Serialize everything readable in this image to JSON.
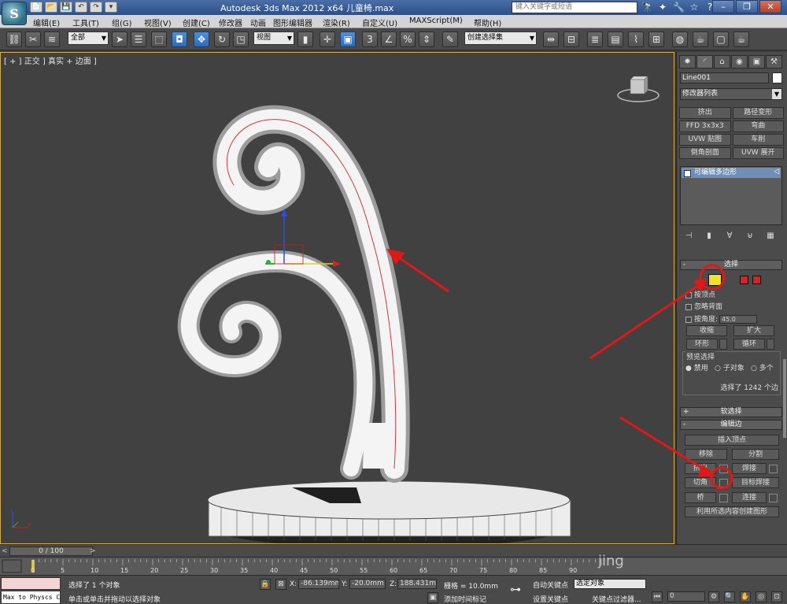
{
  "titlebar": {
    "title": "Autodesk 3ds Max  2012 x64      儿童椅.max",
    "help_search_placeholder": "键入关键字或短语",
    "quick_access": [
      "📄",
      "📂",
      "💾",
      "↶",
      "↷",
      "▾"
    ],
    "icons": [
      "🔭",
      "✦",
      "🔧",
      "☆",
      "?"
    ],
    "window_controls": [
      "–",
      "❐",
      "✕"
    ]
  },
  "menu": {
    "items": [
      "编辑(E)",
      "工具(T)",
      "组(G)",
      "视图(V)",
      "创建(C)",
      "修改器",
      "动画",
      "图形编辑器",
      "渲染(R)",
      "自定义(U)",
      "MAXScript(M)",
      "帮助(H)"
    ]
  },
  "toolbar": {
    "selection_filter": "全部",
    "reference_coord": "视图",
    "named_selection": "创建选择集",
    "snap_label": "3",
    "percent_snap": "%"
  },
  "viewport": {
    "label": "[ + ] 正交 ] 真实 + 边面 ]",
    "active_border": "#d7b04a",
    "background": "#414141"
  },
  "command_panel": {
    "object_name": "Line001",
    "object_color": "#ffffff",
    "modifier_list": "修改器列表",
    "modifier_buttons": [
      "挤出",
      "路径变形",
      "FFD 3x3x3",
      "弯曲",
      "UVW 贴图",
      "车削",
      "倒角剖面",
      "UVW 展开"
    ],
    "stack_item": "可编辑多边形",
    "selection_rollout": {
      "title": "选择",
      "by_vertex": "按顶点",
      "ignore_backfacing": "忽略背面",
      "by_angle": "按角度:",
      "angle_value": "45.0",
      "shrink": "收缩",
      "grow": "扩大",
      "ring": "环形",
      "loop": "循环",
      "preview_title": "预览选择",
      "preview_off": "禁用",
      "preview_subobj": "子对象",
      "preview_multi": "多个",
      "selected_count": "选择了 1242 个边"
    },
    "soft_selection": "软选择",
    "edit_edges": {
      "title": "编辑边",
      "insert_vertex": "插入顶点",
      "remove": "移除",
      "split": "分割",
      "extrude": "挤出",
      "weld": "焊接",
      "chamfer": "切角",
      "target_weld": "目标焊接",
      "bridge": "桥",
      "connect": "连接",
      "create_shape": "利用所选内容创建图形"
    }
  },
  "timeline": {
    "frame_display": "0 / 100",
    "ticks": [
      "0",
      "5",
      "10",
      "15",
      "20",
      "25",
      "30",
      "35",
      "40",
      "45",
      "50",
      "55",
      "60",
      "65",
      "70",
      "75",
      "80",
      "85",
      "90"
    ]
  },
  "status": {
    "maxscript": "Max to Physcs C",
    "selection_info": "选择了 1 个对象",
    "prompt": "单击或单击并拖动以选择对象",
    "x_label": "X:",
    "x_value": "-86.139mm",
    "y_label": "Y:",
    "y_value": "-20.0mm",
    "z_label": "Z:",
    "z_value": "188.431mm",
    "grid": "栅格 = 10.0mm",
    "add_time_tag": "添加时间标记",
    "auto_key": "自动关键点",
    "set_key": "设置关键点",
    "selected_mode": "选定对象",
    "key_filters": "关键点过滤器...",
    "current_frame": "0",
    "watermark": "jing"
  }
}
